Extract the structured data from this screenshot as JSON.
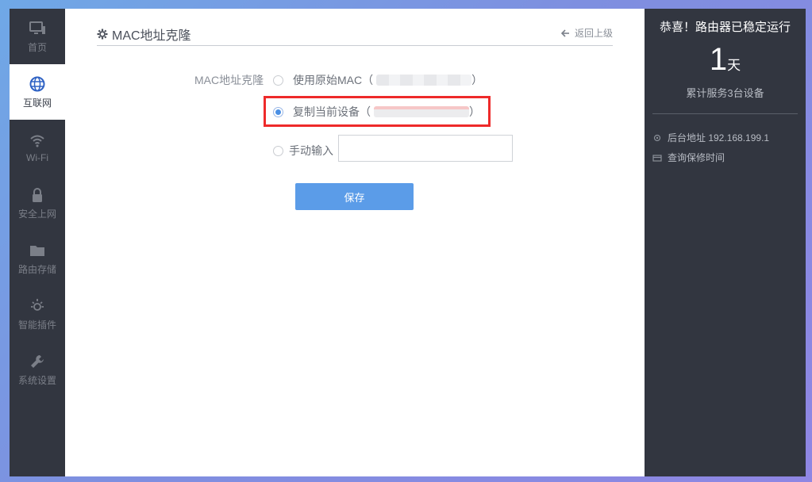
{
  "sidebar": {
    "items": [
      {
        "label": "首页",
        "icon": "monitor-icon"
      },
      {
        "label": "互联网",
        "icon": "globe-icon"
      },
      {
        "label": "Wi-Fi",
        "icon": "wifi-icon"
      },
      {
        "label": "安全上网",
        "icon": "lock-icon"
      },
      {
        "label": "路由存储",
        "icon": "folder-icon"
      },
      {
        "label": "智能插件",
        "icon": "sun-icon"
      },
      {
        "label": "系统设置",
        "icon": "wrench-icon"
      }
    ],
    "active": "互联网"
  },
  "panel": {
    "title": "MAC地址克隆",
    "title_icon": "gear-icon",
    "back_label": "返回上级",
    "back_icon": "arrow-left-icon"
  },
  "form": {
    "field_label": "MAC地址克隆",
    "options": [
      {
        "label": "使用原始MAC（",
        "close": "）",
        "checked": false
      },
      {
        "label": "复制当前设备（",
        "close": "）",
        "checked": true
      },
      {
        "label": "手动输入",
        "checked": false
      }
    ],
    "manual_value": "",
    "save_label": "保存"
  },
  "status": {
    "title": "恭喜！路由器已稳定运行",
    "days": "1",
    "days_unit": "天",
    "served": "累计服务3台设备",
    "admin_address": "后台地址 192.168.199.1",
    "warranty": "查询保修时间"
  },
  "colors": {
    "sidebar_bg": "#323640",
    "accent": "#5b9ce8",
    "highlight": "#ee2a2a"
  }
}
